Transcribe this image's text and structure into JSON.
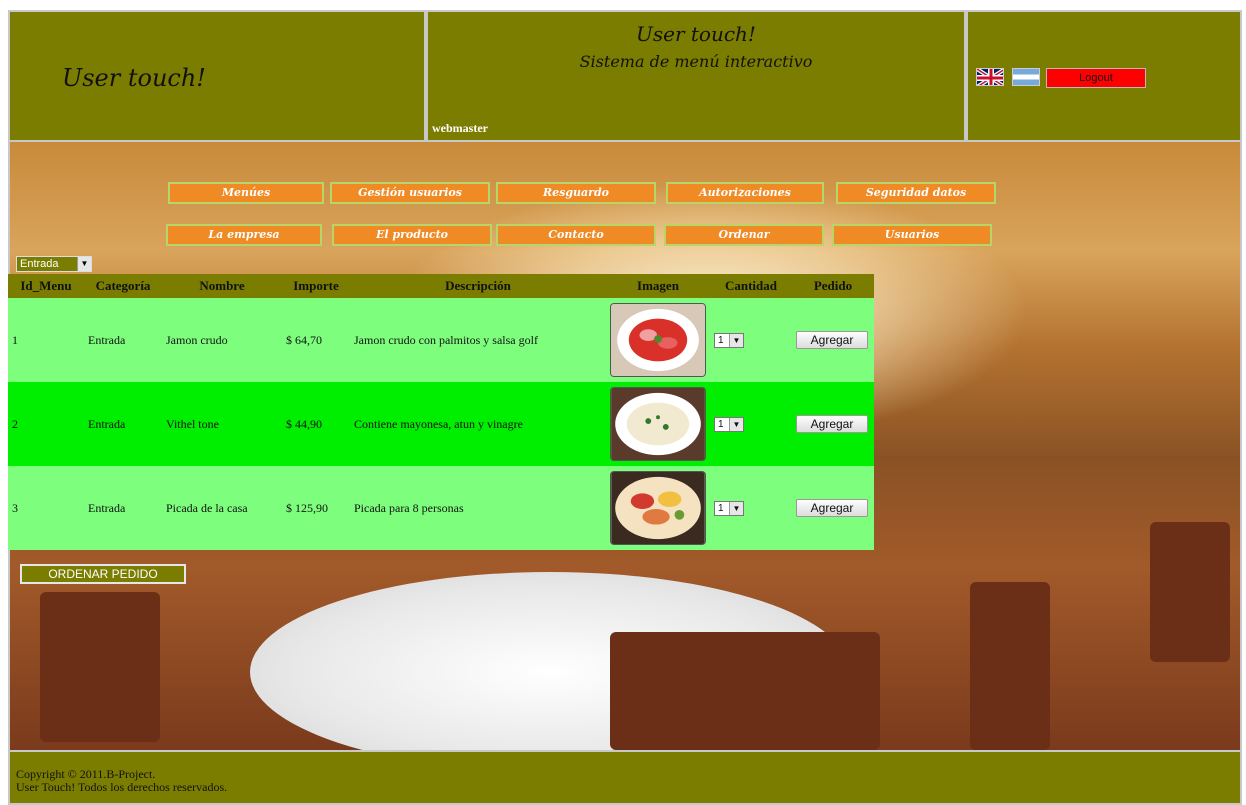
{
  "header": {
    "brand": "User touch!",
    "title": "User touch!",
    "subtitle": "Sistema de menú interactivo",
    "user": "webmaster",
    "logout_label": "Logout"
  },
  "nav": {
    "row1": [
      "Menúes",
      "Gestión usuarios",
      "Resguardo",
      "Autorizaciones",
      "Seguridad datos"
    ],
    "row2": [
      "La empresa",
      "El producto",
      "Contacto",
      "Ordenar",
      "Usuarios"
    ]
  },
  "category_filter": {
    "value": "Entrada"
  },
  "table": {
    "headers": [
      "Id_Menu",
      "Categoría",
      "Nombre",
      "Importe",
      "Descripción",
      "Imagen",
      "Cantidad",
      "Pedido"
    ],
    "rows": [
      {
        "id": "1",
        "categoria": "Entrada",
        "nombre": "Jamon crudo",
        "importe": "$ 64,70",
        "descripcion": "Jamon crudo con palmitos y salsa golf",
        "image": "plate-ham",
        "cantidad": "1",
        "pedido": "Agregar"
      },
      {
        "id": "2",
        "categoria": "Entrada",
        "nombre": "Vithel tone",
        "importe": "$ 44,90",
        "descripcion": "Contiene mayonesa, atun y vinagre",
        "image": "plate-vitel",
        "cantidad": "1",
        "pedido": "Agregar"
      },
      {
        "id": "3",
        "categoria": "Entrada",
        "nombre": "Picada de la casa",
        "importe": "$ 125,90",
        "descripcion": "Picada para 8 personas",
        "image": "plate-picada",
        "cantidad": "1",
        "pedido": "Agregar"
      }
    ]
  },
  "order_button": "ORDENAR PEDIDO",
  "footer": {
    "line1": "Copyright © 2011.B-Project.",
    "line2": "User Touch! Todos los derechos reservados."
  },
  "colors": {
    "olive": "#7b7d00",
    "nav_orange": "#f08a24",
    "row_light": "#7dff7d",
    "row_bright": "#00ef00",
    "logout_red": "#ff0000"
  }
}
